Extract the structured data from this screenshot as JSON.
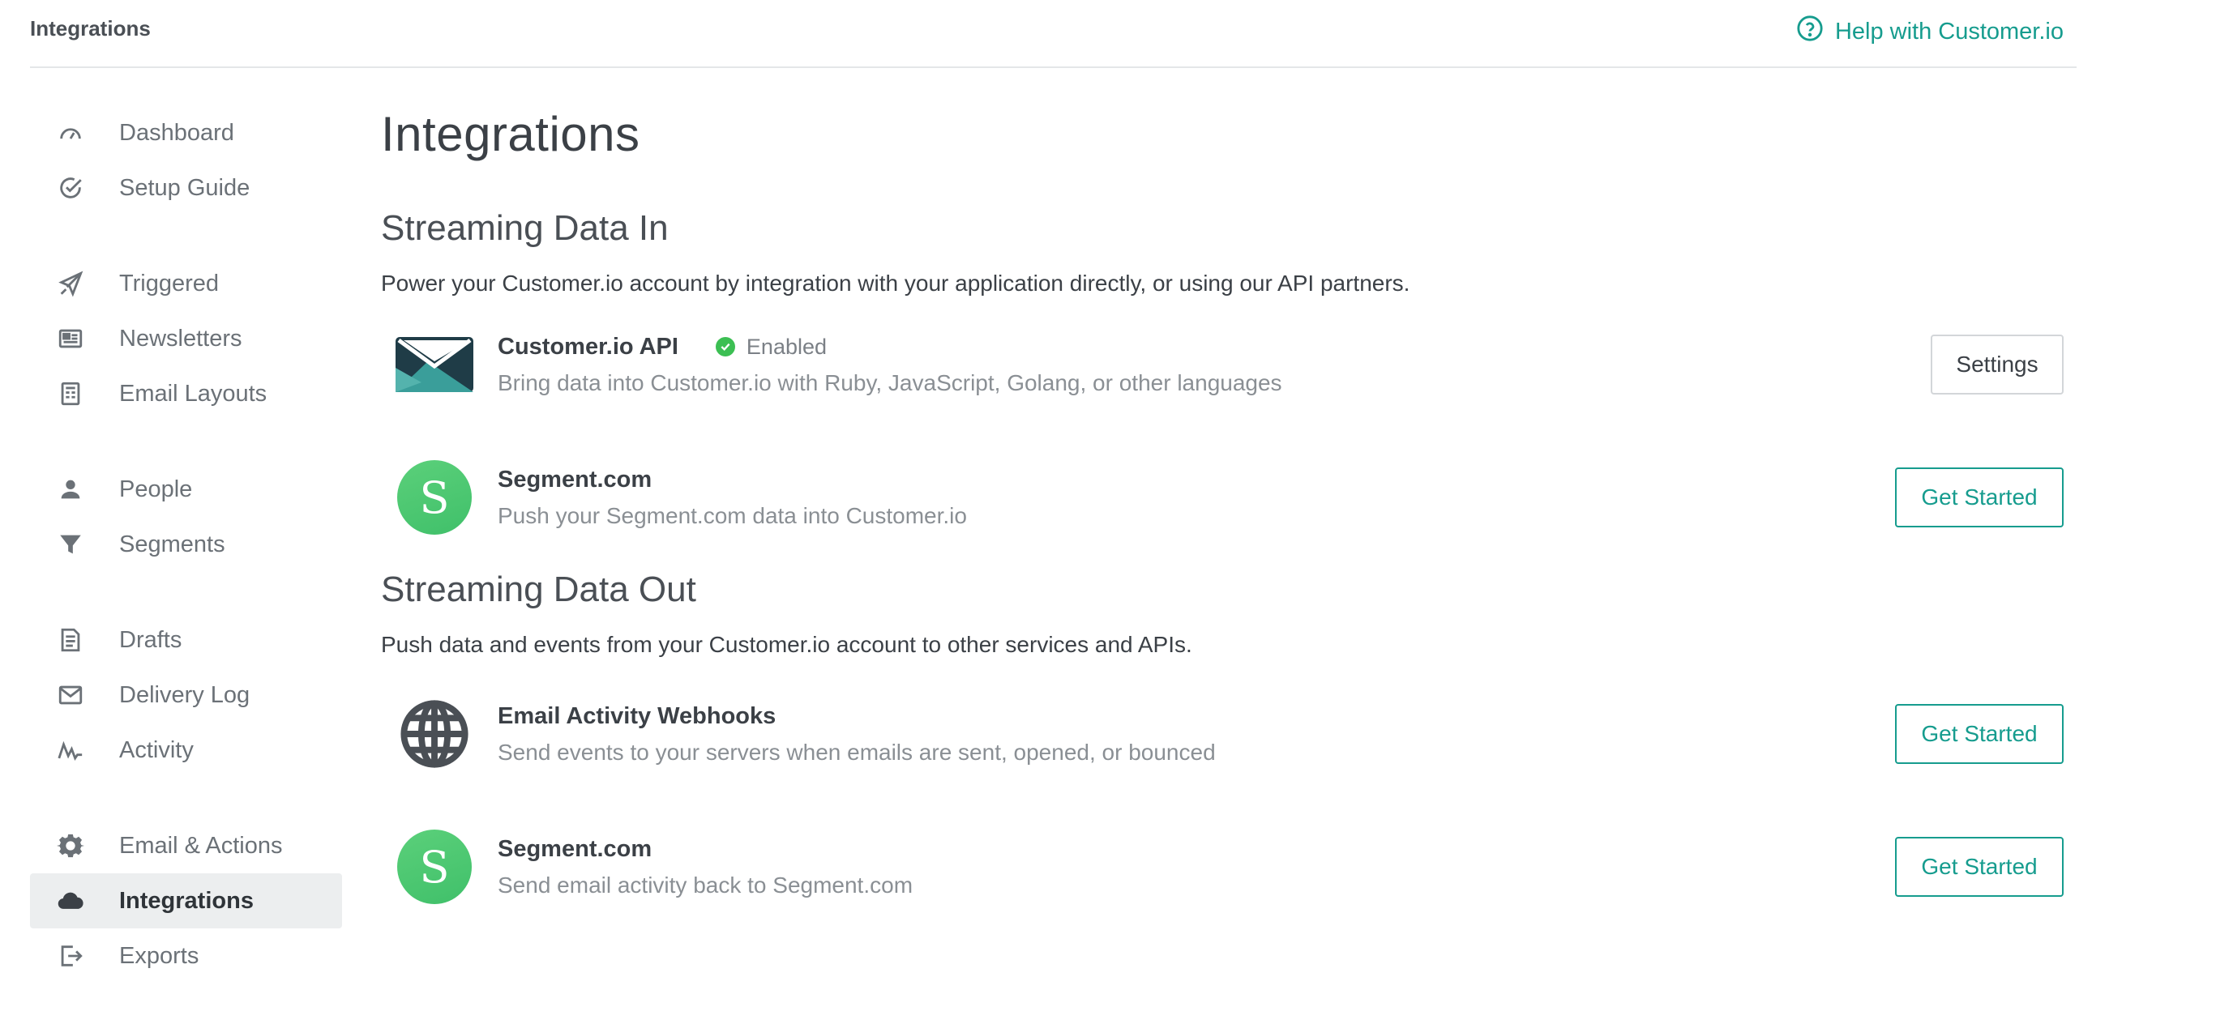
{
  "topbar": {
    "breadcrumb": "Integrations",
    "help_label": "Help with Customer.io"
  },
  "sidebar": {
    "groups": [
      [
        {
          "label": "Dashboard",
          "icon": "gauge-icon"
        },
        {
          "label": "Setup Guide",
          "icon": "check-circle-icon"
        }
      ],
      [
        {
          "label": "Triggered",
          "icon": "paper-plane-icon"
        },
        {
          "label": "Newsletters",
          "icon": "newspaper-icon"
        },
        {
          "label": "Email Layouts",
          "icon": "layout-icon"
        }
      ],
      [
        {
          "label": "People",
          "icon": "person-icon"
        },
        {
          "label": "Segments",
          "icon": "filter-icon"
        }
      ],
      [
        {
          "label": "Drafts",
          "icon": "document-icon"
        },
        {
          "label": "Delivery Log",
          "icon": "envelope-icon"
        },
        {
          "label": "Activity",
          "icon": "activity-icon"
        }
      ],
      [
        {
          "label": "Email & Actions",
          "icon": "gear-icon"
        },
        {
          "label": "Integrations",
          "icon": "cloud-icon",
          "active": true
        },
        {
          "label": "Exports",
          "icon": "export-icon"
        }
      ]
    ]
  },
  "main": {
    "title": "Integrations",
    "sections": [
      {
        "title": "Streaming Data In",
        "description": "Power your Customer.io account by integration with your application directly, or using our API partners.",
        "items": [
          {
            "name": "Customer.io API",
            "status": "Enabled",
            "description": "Bring data into Customer.io with Ruby, JavaScript, Golang, or other languages",
            "button": "Settings",
            "logo": "customerio-envelope-icon"
          },
          {
            "name": "Segment.com",
            "description": "Push your Segment.com data into Customer.io",
            "button": "Get Started",
            "logo": "segment-logo-icon",
            "logo_letter": "S"
          }
        ]
      },
      {
        "title": "Streaming Data Out",
        "description": "Push data and events from your Customer.io account to other services and APIs.",
        "items": [
          {
            "name": "Email Activity Webhooks",
            "description": "Send events to your servers when emails are sent, opened, or bounced",
            "button": "Get Started",
            "logo": "globe-icon"
          },
          {
            "name": "Segment.com",
            "description": "Send email activity back to Segment.com",
            "button": "Get Started",
            "logo": "segment-logo-icon",
            "logo_letter": "S"
          }
        ]
      }
    ]
  },
  "colors": {
    "accent": "#169c8e",
    "enabled": "#3cbf53",
    "segment": "#4cc870"
  }
}
